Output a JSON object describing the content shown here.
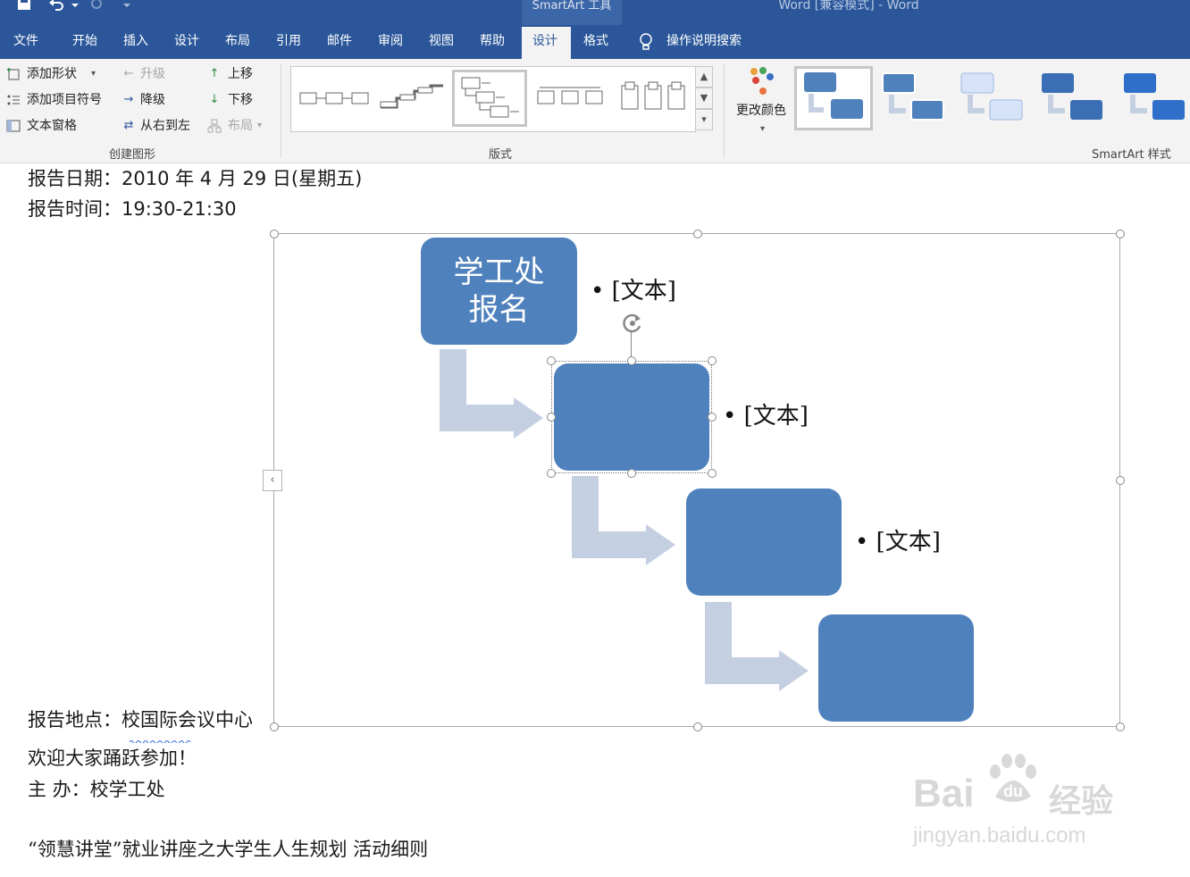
{
  "title_bar": {
    "app_title": "Word [兼容模式]  -  Word",
    "context_group": "SmartArt 工具",
    "qat_icons": [
      "save-icon",
      "undo-icon",
      "redo-icon",
      "customize-icon"
    ]
  },
  "tabs": [
    "文件",
    "开始",
    "插入",
    "设计",
    "布局",
    "引用",
    "邮件",
    "审阅",
    "视图",
    "帮助",
    "设计",
    "格式"
  ],
  "tell_me": "操作说明搜索",
  "ribbon": {
    "create_group": {
      "label": "创建图形",
      "add_shape": "添加形状",
      "add_bullet": "添加项目符号",
      "text_pane": "文本窗格",
      "promote": "升级",
      "demote": "降级",
      "right_to_left": "从右到左",
      "move_up": "上移",
      "move_down": "下移",
      "layout": "布局"
    },
    "layouts_group": {
      "label": "版式"
    },
    "change_colors": "更改颜色",
    "styles_group": {
      "label": "SmartArt 样式"
    }
  },
  "document": {
    "report_date": "报告日期：2010 年 4 月 29 日(星期五)",
    "report_time": "报告时间：19:30-21:30",
    "report_place": "报告地点：校国际会议中心",
    "welcome": "欢迎大家踊跃参加！",
    "host": "主  办：校学工处",
    "footer_title": "“领慧讲堂”就业讲座之大学生人生规划  活动细则"
  },
  "smartart": {
    "first_box_text": "学工处\n报名",
    "bullet_text": "• [文本]"
  },
  "colors": {
    "ribbon_blue": "#2b579a",
    "shape_blue": "#4f81bd",
    "arrow_gray": "#c5cfe2"
  },
  "watermark": {
    "brand": "Bai",
    "brand_suffix": "经验",
    "url": "jingyan.baidu.com"
  }
}
